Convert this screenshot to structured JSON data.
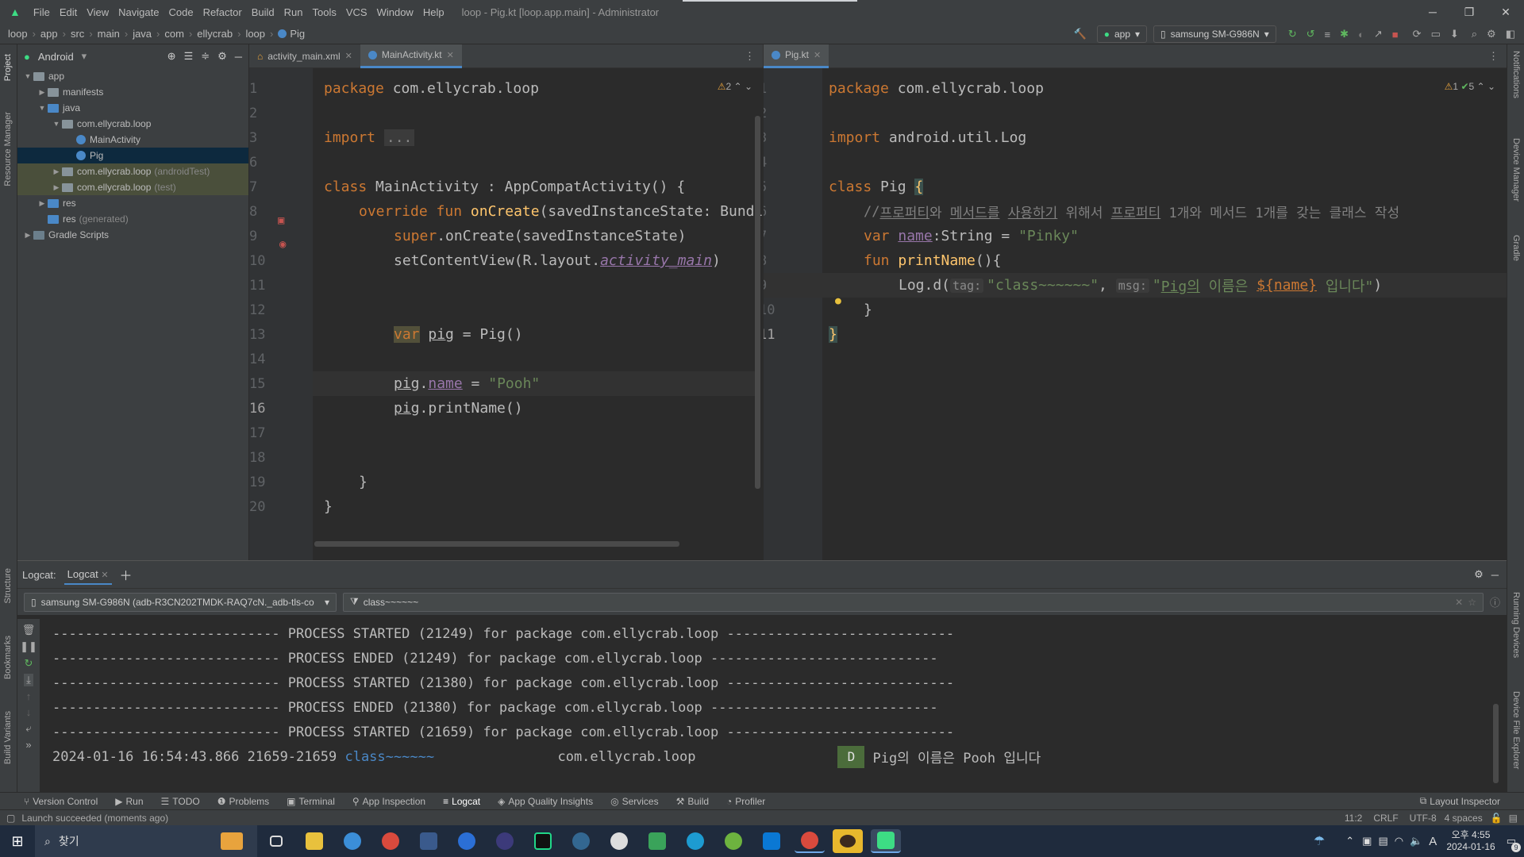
{
  "menu": {
    "items": [
      "File",
      "Edit",
      "View",
      "Navigate",
      "Code",
      "Refactor",
      "Build",
      "Run",
      "Tools",
      "VCS",
      "Window",
      "Help"
    ],
    "window_title": "loop - Pig.kt [loop.app.main] - Administrator"
  },
  "breadcrumb": [
    "loop",
    "app",
    "src",
    "main",
    "java",
    "com",
    "ellycrab",
    "loop",
    "Pig"
  ],
  "toolbar": {
    "run_config": "app",
    "device": "samsung SM-G986N"
  },
  "project": {
    "view_mode": "Android",
    "tree": [
      {
        "label": "app",
        "depth": 0,
        "open": true,
        "type": "folder"
      },
      {
        "label": "manifests",
        "depth": 1,
        "open": false,
        "type": "folder"
      },
      {
        "label": "java",
        "depth": 1,
        "open": true,
        "type": "folder"
      },
      {
        "label": "com.ellycrab.loop",
        "depth": 2,
        "open": true,
        "type": "folder"
      },
      {
        "label": "MainActivity",
        "depth": 3,
        "type": "kotlin"
      },
      {
        "label": "Pig",
        "depth": 3,
        "type": "kotlin",
        "selected": true
      },
      {
        "label": "com.ellycrab.loop",
        "suffix": "(androidTest)",
        "depth": 2,
        "open": false,
        "type": "folder",
        "hl": true
      },
      {
        "label": "com.ellycrab.loop",
        "suffix": "(test)",
        "depth": 2,
        "open": false,
        "type": "folder",
        "hl": true
      },
      {
        "label": "res",
        "depth": 1,
        "open": false,
        "type": "folder"
      },
      {
        "label": "res",
        "suffix": "(generated)",
        "depth": 1,
        "type": "folder"
      },
      {
        "label": "Gradle Scripts",
        "depth": 0,
        "open": false,
        "type": "gradle"
      }
    ]
  },
  "left_editor": {
    "tabs": [
      "activity_main.xml",
      "MainActivity.kt"
    ],
    "active_tab": "MainActivity.kt",
    "warnings": "2",
    "line_numbers": [
      "1",
      "2",
      "3",
      "6",
      "7",
      "8",
      "9",
      "10",
      "11",
      "12",
      "13",
      "14",
      "15",
      "16",
      "17",
      "18",
      "19",
      "20"
    ],
    "code": {
      "l1a": "package",
      "l1b": " com.ellycrab.loop",
      "l3a": "import",
      "l3b": "...",
      "l7a": "class",
      "l7b": " MainActivity : AppCompatActivity() {",
      "l8a": "override fun ",
      "l8b": "onCreate",
      "l8c": "(savedInstanceState: Bundle",
      "l9a": "super",
      "l9b": ".onCreate(savedInstanceState)",
      "l10a": "setContentView(R.layout.",
      "l10b": "activity_main",
      "l10c": ")",
      "l13a": "var",
      "l13b": "pig",
      "l13c": " = Pig()",
      "l15a": "pig",
      "l15b": ".",
      "l15c": "name",
      "l15d": " = ",
      "l15e": "\"Pooh\"",
      "l16a": "pig",
      "l16b": ".printName()",
      "l19": "}",
      "l20": "}"
    }
  },
  "right_editor": {
    "tabs": [
      "Pig.kt"
    ],
    "inspections": {
      "warn": "1",
      "ok": "5"
    },
    "line_numbers": [
      "1",
      "2",
      "3",
      "4",
      "5",
      "6",
      "7",
      "8",
      "9",
      "10",
      "11"
    ],
    "code": {
      "l1a": "package",
      "l1b": " com.ellycrab.loop",
      "l3a": "import",
      "l3b": " android.util.Log",
      "l5a": "class",
      "l5b": " Pig ",
      "l5c": "{",
      "l6a": "//",
      "l6b": "프로퍼티",
      "l6c": "와 ",
      "l6d": "메서드를",
      "l6e": " ",
      "l6f": "사용하기",
      "l6g": " 위해서 ",
      "l6h": "프로퍼티",
      "l6i": " 1개와 메서드 1개를 갖는 클래스 작성",
      "l7a": "var ",
      "l7b": "name",
      "l7c": ":String = ",
      "l7d": "\"Pinky\"",
      "l8a": "fun ",
      "l8b": "printName",
      "l8c": "(){",
      "l9a": "Log.d(",
      "l9tag": "tag:",
      "l9b": "\"class~~~~~~\"",
      "l9c": ", ",
      "l9msg": "msg:",
      "l9d": "\"",
      "l9e": "Pig의",
      "l9f": " 이름은 ",
      "l9g": "${name}",
      "l9h": " 입니다\"",
      "l9i": ")",
      "l10": "}",
      "l11": "}"
    }
  },
  "logcat": {
    "title": "Logcat:",
    "tab": "Logcat",
    "device": "samsung SM-G986N (adb-R3CN202TMDK-RAQ7cN._adb-tls-co",
    "filter": "class~~~~~~",
    "lines": [
      "---------------------------- PROCESS STARTED (21249) for package com.ellycrab.loop ----------------------------",
      "---------------------------- PROCESS ENDED (21249) for package com.ellycrab.loop ----------------------------",
      "---------------------------- PROCESS STARTED (21380) for package com.ellycrab.loop ----------------------------",
      "---------------------------- PROCESS ENDED (21380) for package com.ellycrab.loop ----------------------------",
      "---------------------------- PROCESS STARTED (21659) for package com.ellycrab.loop ----------------------------"
    ],
    "entry": {
      "time": "2024-01-16 16:54:43.866 21659-21659 ",
      "tag": "class~~~~~~",
      "pkg": "com.ellycrab.loop",
      "level": "D",
      "msg": "Pig의 이름은 Pooh 입니다"
    }
  },
  "tool_windows": [
    "Version Control",
    "Run",
    "TODO",
    "Problems",
    "Terminal",
    "App Inspection",
    "Logcat",
    "App Quality Insights",
    "Services",
    "Build",
    "Profiler"
  ],
  "layout_inspector": "Layout Inspector",
  "side_labels": {
    "project": "Project",
    "resource_manager": "Resource Manager",
    "structure": "Structure",
    "bookmarks": "Bookmarks",
    "build_variants": "Build Variants",
    "notifications": "Notifications",
    "device_manager": "Device Manager",
    "gradle": "Gradle",
    "running_devices": "Running Devices",
    "device_file_explorer": "Device File Explorer"
  },
  "status": {
    "message": "Launch succeeded (moments ago)",
    "position": "11:2",
    "line_sep": "CRLF",
    "encoding": "UTF-8",
    "indent": "4 spaces"
  },
  "taskbar": {
    "search": "찾기",
    "time": "오후 4:55",
    "date": "2024-01-16",
    "ime": "A",
    "notif_count": "9"
  }
}
